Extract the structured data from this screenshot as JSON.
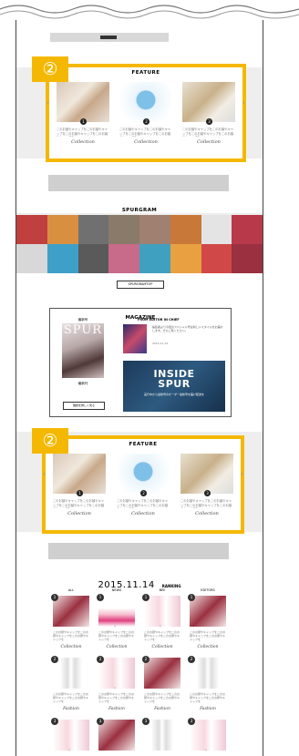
{
  "badges": [
    "②",
    "②"
  ],
  "feature": {
    "title": "FEATURE",
    "card_text": "このお顔やキャップをこのお顔やキャップをこのお顔やキャップをこのお顔やキャップを",
    "card_sig": "Collection",
    "prev": "‹",
    "next": "›"
  },
  "spurgram": {
    "title": "SPURGRAM",
    "button": "SPURGRAMTOP"
  },
  "magazine": {
    "title": "MAGAZINE",
    "left_label": "最新号",
    "cover_title": "SPUR",
    "cover_sub": "最新刊",
    "left_button": "雑誌を詳しく見る",
    "right_label": "FROM EDITOR IN CHIEF",
    "right_text": "編集長より今回のスペシャル号は新しいスタイルをお届けします。ぜひご覧ください。",
    "right_date": "2015.11.14",
    "inside": "INSIDE",
    "spur": "SPUR",
    "inside_sub": "実行中から最新号のオーダー最新号を届け配送を"
  },
  "ranking": {
    "date": "2015.11.14",
    "label": "RANKING",
    "columns": [
      "ALL",
      "NEWS",
      "BEE",
      "EDITORS"
    ],
    "sig1": "Collection",
    "sig2": "Fashion",
    "text": "このお顔やキャップをこのお顔やキャップをこのお顔やキャップを"
  },
  "colors": {
    "accent": "#f5b800"
  }
}
